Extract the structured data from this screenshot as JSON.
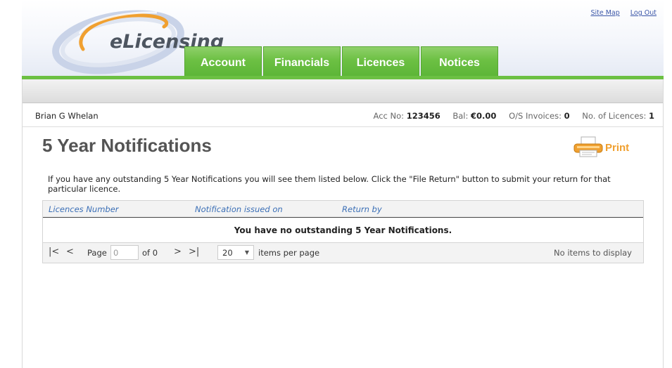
{
  "header": {
    "logo_text": "eLicensing",
    "links": {
      "site_map": "Site Map",
      "log_out": "Log Out"
    },
    "tabs": [
      {
        "label": "Account"
      },
      {
        "label": "Financials"
      },
      {
        "label": "Licences"
      },
      {
        "label": "Notices"
      }
    ],
    "colors": {
      "tab_green": "#6cc043",
      "link_blue": "#3b57a8"
    }
  },
  "info_bar": {
    "user_name": "Brian G Whelan",
    "acc_no_label": "Acc No:",
    "acc_no": "123456",
    "bal_label": "Bal:",
    "bal": "€0.00",
    "invoices_label": "O/S Invoices:",
    "invoices": "0",
    "licences_label": "No. of Licences:",
    "licences": "1"
  },
  "main": {
    "title": "5 Year Notifications",
    "print_label": "Print",
    "intro": "If you have any outstanding 5 Year Notifications you will see them listed below. Click the \"File Return\" button to submit your return for that particular licence.",
    "grid": {
      "columns": [
        "Licences Number",
        "Notification issued on",
        "Return by"
      ],
      "empty_message": "You have no outstanding 5 Year Notifications.",
      "pager": {
        "page_label": "Page",
        "page_value": "0",
        "of_label": "of 0",
        "per_page": "20",
        "per_page_label": "items per page",
        "status": "No items to display"
      }
    }
  }
}
